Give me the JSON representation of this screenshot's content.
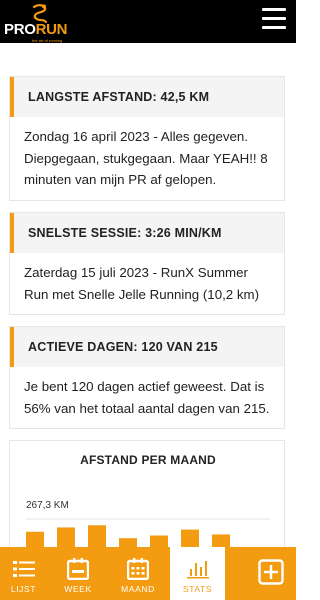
{
  "header": {
    "logo_word_pro": "PRO",
    "logo_word_run": "RUN",
    "logo_tagline": "the art of running"
  },
  "cards": [
    {
      "title": "LANGSTE AFSTAND: 42,5 KM",
      "text": "Zondag 16 april 2023 - Alles gegeven. Diepgegaan, stukgegaan. Maar YEAH!! 8 minuten van mijn PR af gelopen."
    },
    {
      "title": "SNELSTE SESSIE: 3:26 MIN/KM",
      "text": "Zaterdag 15 juli 2023 - RunX Summer Run met Snelle Jelle Running (10,2 km)"
    },
    {
      "title": "ACTIEVE DAGEN: 120 VAN 215",
      "text": "Je bent 120 dagen actief geweest. Dat is 56% van het totaal aantal dagen van 215."
    }
  ],
  "chart_data": {
    "type": "bar",
    "title": "AFSTAND PER MAAND",
    "max_label": "267,3 KM",
    "values": [
      220,
      236,
      244,
      196,
      206,
      228,
      210
    ],
    "ylim": [
      0,
      267.3
    ],
    "bar_color": "#f39c12"
  },
  "nav": {
    "items": [
      {
        "label": "LIJST",
        "icon": "list-icon"
      },
      {
        "label": "WEEK",
        "icon": "calendar-week-icon"
      },
      {
        "label": "MAAND",
        "icon": "calendar-month-icon"
      },
      {
        "label": "STATS",
        "icon": "bar-chart-icon",
        "active": true
      }
    ],
    "add_icon": "plus-square-icon"
  },
  "colors": {
    "accent": "#f39c12",
    "header_bg": "#000000"
  }
}
